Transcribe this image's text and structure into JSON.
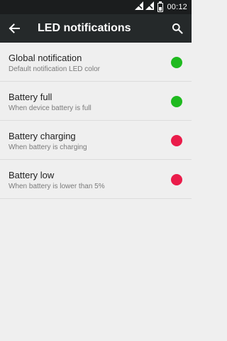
{
  "status_bar": {
    "time": "00:12",
    "battery_level": 0.55
  },
  "app_bar": {
    "title": "LED notifications",
    "back_icon": "arrow-back-icon",
    "search_icon": "search-icon"
  },
  "items": [
    {
      "title": "Global notification",
      "subtitle": "Default notification LED color",
      "color": "#1fba1f"
    },
    {
      "title": "Battery full",
      "subtitle": "When device battery is full",
      "color": "#1fba1f"
    },
    {
      "title": "Battery charging",
      "subtitle": "When battery is charging",
      "color": "#ea1c4a"
    },
    {
      "title": "Battery low",
      "subtitle": "When battery is lower than 5%",
      "color": "#ea1c4a"
    }
  ]
}
